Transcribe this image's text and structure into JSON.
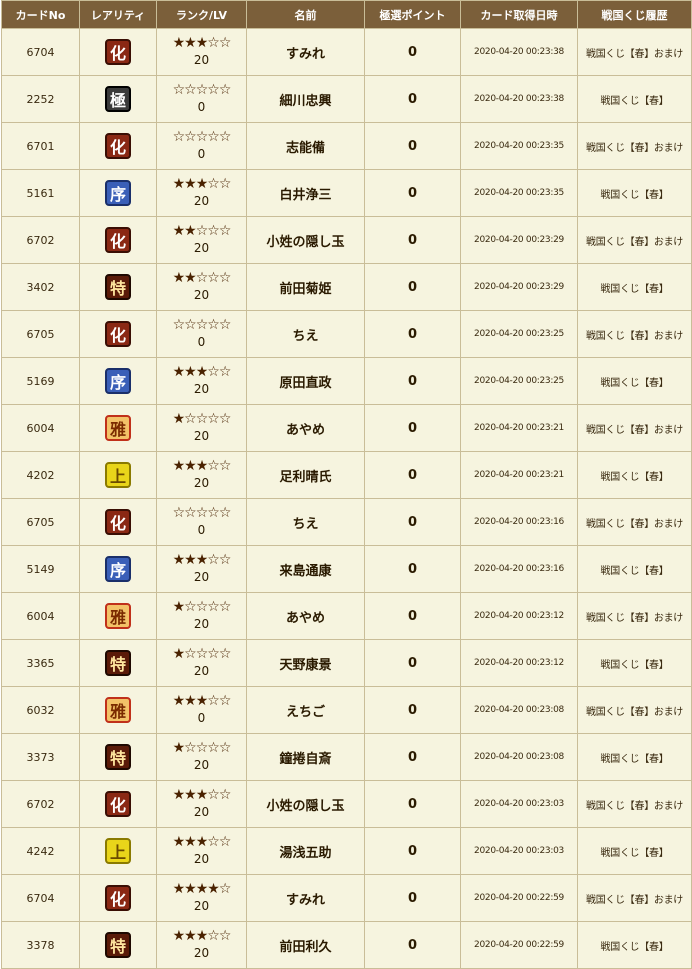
{
  "headers": {
    "card_no": "カードNo",
    "rarity": "レアリティ",
    "rank_lv": "ランク/LV",
    "name": "名前",
    "points": "極選ポイント",
    "date": "カード取得日時",
    "history": "戦国くじ履歴"
  },
  "rarity_styles": {
    "化": {
      "bg": "#8a2814",
      "fg": "#ffffff",
      "border": "#3a0e04"
    },
    "極": {
      "bg": "#3a3a3a",
      "fg": "#ffffff",
      "border": "#000000"
    },
    "序": {
      "bg": "#3a5fb8",
      "fg": "#ffffff",
      "border": "#1a2f6a"
    },
    "特": {
      "bg": "#5a1a08",
      "fg": "#ffe7a0",
      "border": "#1e0800"
    },
    "雅": {
      "bg": "#f3c268",
      "fg": "#7a2a00",
      "border": "#c0301a"
    },
    "上": {
      "bg": "#e9d51a",
      "fg": "#6a4a00",
      "border": "#8a7a00"
    }
  },
  "rows": [
    {
      "no": "6704",
      "rarity": "化",
      "stars": "★★★☆☆",
      "lv": "20",
      "name": "すみれ",
      "points": "0",
      "date": "2020-04-20 00:23:38",
      "history": "戦国くじ【春】おまけ"
    },
    {
      "no": "2252",
      "rarity": "極",
      "stars": "☆☆☆☆☆",
      "lv": "0",
      "name": "細川忠興",
      "points": "0",
      "date": "2020-04-20 00:23:38",
      "history": "戦国くじ【春】"
    },
    {
      "no": "6701",
      "rarity": "化",
      "stars": "☆☆☆☆☆",
      "lv": "0",
      "name": "志能備",
      "points": "0",
      "date": "2020-04-20 00:23:35",
      "history": "戦国くじ【春】おまけ"
    },
    {
      "no": "5161",
      "rarity": "序",
      "stars": "★★★☆☆",
      "lv": "20",
      "name": "白井浄三",
      "points": "0",
      "date": "2020-04-20 00:23:35",
      "history": "戦国くじ【春】"
    },
    {
      "no": "6702",
      "rarity": "化",
      "stars": "★★☆☆☆",
      "lv": "20",
      "name": "小姓の隠し玉",
      "points": "0",
      "date": "2020-04-20 00:23:29",
      "history": "戦国くじ【春】おまけ"
    },
    {
      "no": "3402",
      "rarity": "特",
      "stars": "★★☆☆☆",
      "lv": "20",
      "name": "前田菊姫",
      "points": "0",
      "date": "2020-04-20 00:23:29",
      "history": "戦国くじ【春】"
    },
    {
      "no": "6705",
      "rarity": "化",
      "stars": "☆☆☆☆☆",
      "lv": "0",
      "name": "ちえ",
      "points": "0",
      "date": "2020-04-20 00:23:25",
      "history": "戦国くじ【春】おまけ"
    },
    {
      "no": "5169",
      "rarity": "序",
      "stars": "★★★☆☆",
      "lv": "20",
      "name": "原田直政",
      "points": "0",
      "date": "2020-04-20 00:23:25",
      "history": "戦国くじ【春】"
    },
    {
      "no": "6004",
      "rarity": "雅",
      "stars": "★☆☆☆☆",
      "lv": "20",
      "name": "あやめ",
      "points": "0",
      "date": "2020-04-20 00:23:21",
      "history": "戦国くじ【春】おまけ"
    },
    {
      "no": "4202",
      "rarity": "上",
      "stars": "★★★☆☆",
      "lv": "20",
      "name": "足利晴氏",
      "points": "0",
      "date": "2020-04-20 00:23:21",
      "history": "戦国くじ【春】"
    },
    {
      "no": "6705",
      "rarity": "化",
      "stars": "☆☆☆☆☆",
      "lv": "0",
      "name": "ちえ",
      "points": "0",
      "date": "2020-04-20 00:23:16",
      "history": "戦国くじ【春】おまけ"
    },
    {
      "no": "5149",
      "rarity": "序",
      "stars": "★★★☆☆",
      "lv": "20",
      "name": "来島通康",
      "points": "0",
      "date": "2020-04-20 00:23:16",
      "history": "戦国くじ【春】"
    },
    {
      "no": "6004",
      "rarity": "雅",
      "stars": "★☆☆☆☆",
      "lv": "20",
      "name": "あやめ",
      "points": "0",
      "date": "2020-04-20 00:23:12",
      "history": "戦国くじ【春】おまけ"
    },
    {
      "no": "3365",
      "rarity": "特",
      "stars": "★☆☆☆☆",
      "lv": "20",
      "name": "天野康景",
      "points": "0",
      "date": "2020-04-20 00:23:12",
      "history": "戦国くじ【春】"
    },
    {
      "no": "6032",
      "rarity": "雅",
      "stars": "★★★☆☆",
      "lv": "0",
      "name": "えちご",
      "points": "0",
      "date": "2020-04-20 00:23:08",
      "history": "戦国くじ【春】おまけ"
    },
    {
      "no": "3373",
      "rarity": "特",
      "stars": "★☆☆☆☆",
      "lv": "20",
      "name": "鐘捲自斎",
      "points": "0",
      "date": "2020-04-20 00:23:08",
      "history": "戦国くじ【春】"
    },
    {
      "no": "6702",
      "rarity": "化",
      "stars": "★★★☆☆",
      "lv": "20",
      "name": "小姓の隠し玉",
      "points": "0",
      "date": "2020-04-20 00:23:03",
      "history": "戦国くじ【春】おまけ"
    },
    {
      "no": "4242",
      "rarity": "上",
      "stars": "★★★☆☆",
      "lv": "20",
      "name": "湯浅五助",
      "points": "0",
      "date": "2020-04-20 00:23:03",
      "history": "戦国くじ【春】"
    },
    {
      "no": "6704",
      "rarity": "化",
      "stars": "★★★★☆",
      "lv": "20",
      "name": "すみれ",
      "points": "0",
      "date": "2020-04-20 00:22:59",
      "history": "戦国くじ【春】おまけ"
    },
    {
      "no": "3378",
      "rarity": "特",
      "stars": "★★★☆☆",
      "lv": "20",
      "name": "前田利久",
      "points": "0",
      "date": "2020-04-20 00:22:59",
      "history": "戦国くじ【春】"
    }
  ]
}
